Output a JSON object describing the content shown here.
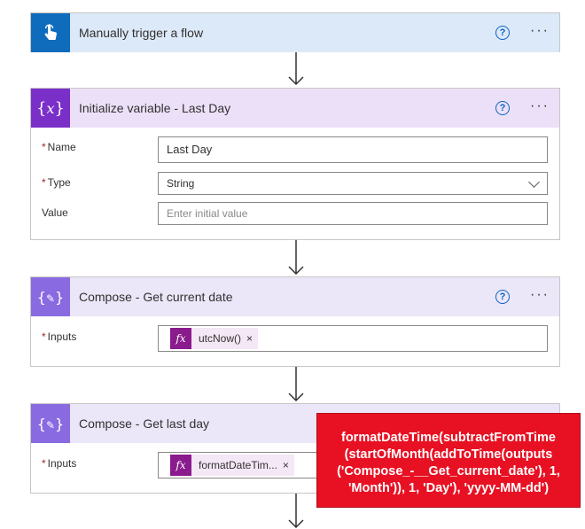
{
  "colors": {
    "trigger_header": "#dce9f8",
    "trigger_icon": "#0f6cbd",
    "variable_header": "#ece0f8",
    "variable_icon": "#7b2fc9",
    "compose_header": "#ebe6f8",
    "compose_icon": "#8a6ae0",
    "function_token": "#8a1b8d",
    "tooltip": "#e81123"
  },
  "trigger": {
    "title": "Manually trigger a flow",
    "icon": "touch-hand-icon"
  },
  "init_variable": {
    "title": "Initialize variable - Last Day",
    "icon": "variable-braces-icon",
    "name_label": "Name",
    "name_value": "Last Day",
    "type_label": "Type",
    "type_value": "String",
    "value_label": "Value",
    "value_placeholder": "Enter initial value"
  },
  "compose_current": {
    "title": "Compose - Get current date",
    "icon": "compose-icon",
    "inputs_label": "Inputs",
    "token_label": "utcNow()"
  },
  "compose_last": {
    "title": "Compose - Get last day",
    "icon": "compose-icon",
    "inputs_label": "Inputs",
    "token_label": "formatDateTim..."
  },
  "common": {
    "help": "?",
    "more": "···",
    "required": "*",
    "fx": "fx",
    "remove": "×"
  },
  "tooltip": {
    "text": "formatDateTime(subtractFromTime (startOfMonth(addToTime(outputs ('Compose_-__Get_current_date'), 1, 'Month')), 1, 'Day'), 'yyyy-MM-dd')"
  }
}
